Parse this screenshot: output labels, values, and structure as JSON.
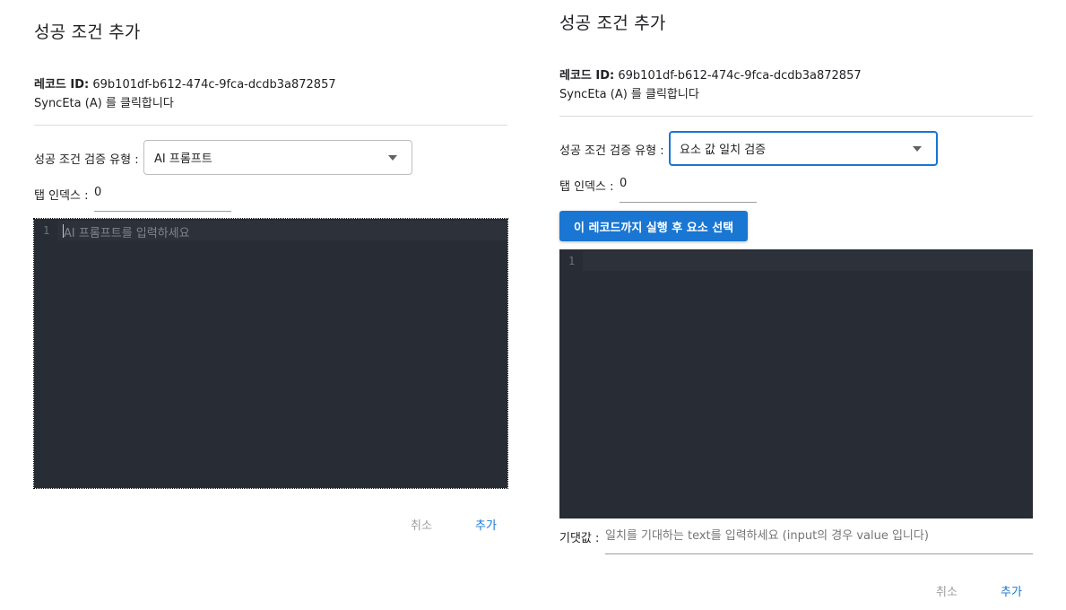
{
  "left_dialog": {
    "title": "성공 조건 추가",
    "record_id_label": "레코드 ID:",
    "record_id_value": "69b101df-b612-474c-9fca-dcdb3a872857",
    "description": "SyncEta (A) 를 클릭합니다",
    "validation_type_label": "성공 조건 검증 유형 :",
    "validation_type_value": "AI 프롬프트",
    "tab_index_label": "탭 인덱스 :",
    "tab_index_value": "0",
    "editor": {
      "line_number": "1",
      "placeholder": "AI 프롬프트를 입력하세요"
    },
    "cancel_label": "취소",
    "add_label": "추가"
  },
  "right_dialog": {
    "title": "성공 조건 추가",
    "record_id_label": "레코드 ID:",
    "record_id_value": "69b101df-b612-474c-9fca-dcdb3a872857",
    "description": "SyncEta (A) 를 클릭합니다",
    "validation_type_label": "성공 조건 검증 유형 :",
    "validation_type_value": "요소 값 일치 검증",
    "tab_index_label": "탭 인덱스 :",
    "tab_index_value": "0",
    "run_select_button": "이 레코드까지 실행 후 요소 선택",
    "editor": {
      "line_number": "1"
    },
    "expected_label": "기댓값 :",
    "expected_placeholder": "일치를 기대하는 text를 입력하세요 (input의 경우 value 입니다)",
    "cancel_label": "취소",
    "add_label": "추가"
  },
  "colors": {
    "accent": "#1976d2",
    "editor_bg": "#282c34",
    "muted": "#9e9e9e"
  }
}
